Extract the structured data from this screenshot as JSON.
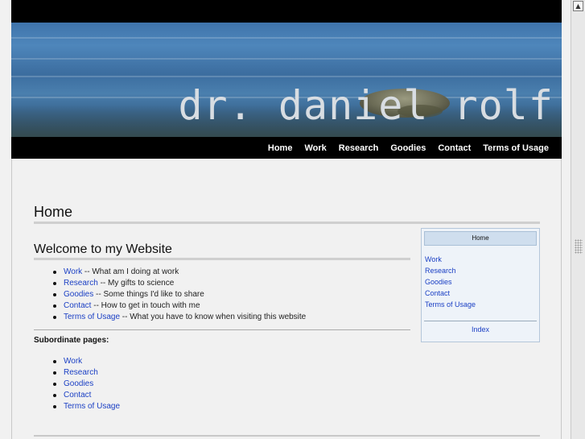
{
  "header": {
    "site_title": "dr. daniel rolf"
  },
  "nav": [
    {
      "label": "Home"
    },
    {
      "label": "Work"
    },
    {
      "label": "Research"
    },
    {
      "label": "Goodies"
    },
    {
      "label": "Contact"
    },
    {
      "label": "Terms of Usage"
    }
  ],
  "main": {
    "page_title": "Home",
    "section_title": "Welcome to my Website",
    "welcome_items": [
      {
        "link": "Work",
        "desc": " -- What am I doing at work"
      },
      {
        "link": "Research",
        "desc": " -- My gifts to science"
      },
      {
        "link": "Goodies",
        "desc": " -- Some things I'd like to share"
      },
      {
        "link": "Contact",
        "desc": " -- How to get in touch with me"
      },
      {
        "link": "Terms of Usage",
        "desc": " -- What you have to know when visiting this website"
      }
    ],
    "subordinate_heading": "Subordinate pages:",
    "subordinate_items": [
      "Work",
      "Research",
      "Goodies",
      "Contact",
      "Terms of Usage"
    ]
  },
  "sidebox": {
    "heading": "Home",
    "links": [
      "Work",
      "Research",
      "Goodies",
      "Contact",
      "Terms of Usage"
    ],
    "index_label": "Index"
  },
  "scrollbar": {
    "up_arrow_icon": "triangle-up-icon"
  }
}
